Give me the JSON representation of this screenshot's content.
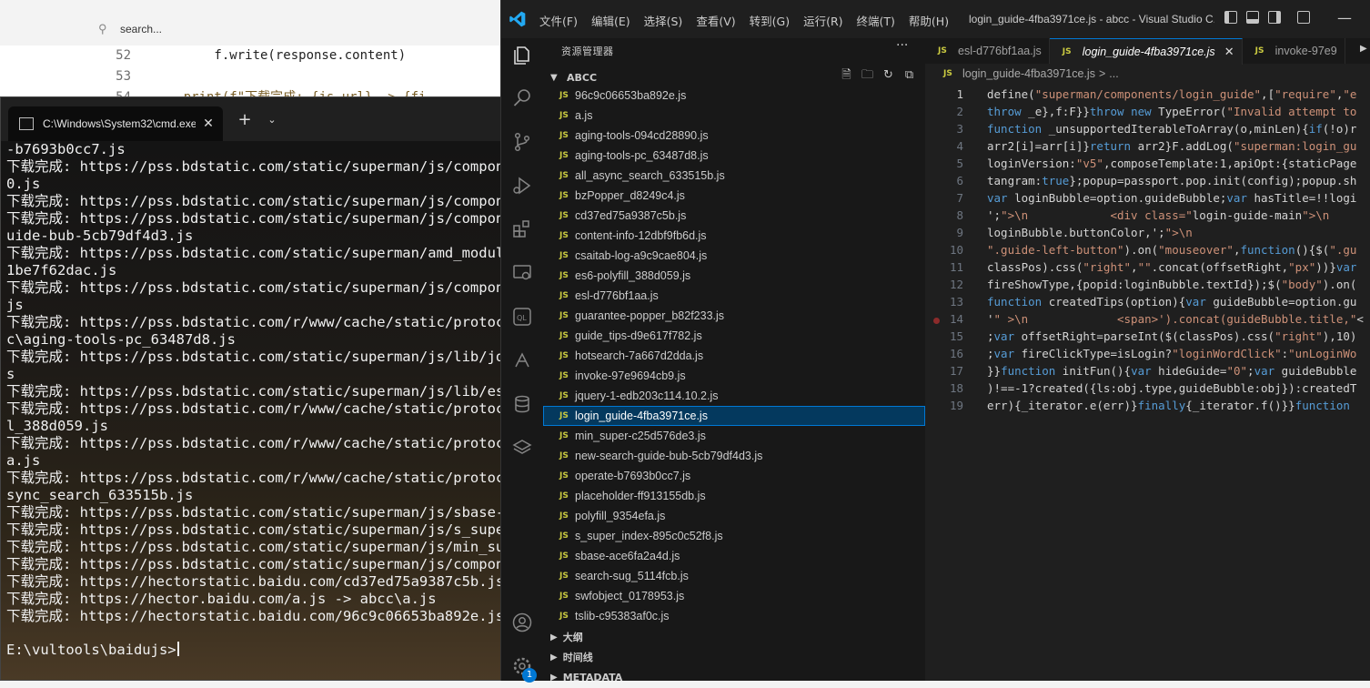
{
  "bg_editor": {
    "search_placeholder": "search...",
    "lines": [
      {
        "num": "52",
        "text": "        f.write(response.content)"
      },
      {
        "num": "53",
        "text": ""
      },
      {
        "num": "54",
        "text": "    print(f\"下载完成: {js_url} -> {fi"
      }
    ]
  },
  "cmd": {
    "tab_title": "C:\\Windows\\System32\\cmd.exe",
    "lines": [
      "-b7693b0cc7.js",
      "下载完成: https://pss.bdstatic.com/static/superman/js/compone",
      "0.js",
      "下载完成: https://pss.bdstatic.com/static/superman/js/compone",
      "下载完成: https://pss.bdstatic.com/static/superman/js/compone",
      "uide-bub-5cb79df4d3.js",
      "下载完成: https://pss.bdstatic.com/static/superman/amd_module",
      "1be7f62dac.js",
      "下载完成: https://pss.bdstatic.com/static/superman/js/compone",
      "js",
      "下载完成: https://pss.bdstatic.com/r/www/cache/static/protoco",
      "c\\aging-tools-pc_63487d8.js",
      "下载完成: https://pss.bdstatic.com/static/superman/js/lib/jqu",
      "s",
      "下载完成: https://pss.bdstatic.com/static/superman/js/lib/esl",
      "下载完成: https://pss.bdstatic.com/r/www/cache/static/protoco",
      "l_388d059.js",
      "下载完成: https://pss.bdstatic.com/r/www/cache/static/protoco",
      "a.js",
      "下载完成: https://pss.bdstatic.com/r/www/cache/static/protoco",
      "sync_search_633515b.js",
      "下载完成: https://pss.bdstatic.com/static/superman/js/sbase-a",
      "下载完成: https://pss.bdstatic.com/static/superman/js/s_super",
      "下载完成: https://pss.bdstatic.com/static/superman/js/min_sup",
      "下载完成: https://pss.bdstatic.com/static/superman/js/compone",
      "下载完成: https://hectorstatic.baidu.com/cd37ed75a9387c5b.js",
      "下载完成: https://hector.baidu.com/a.js -> abcc\\a.js",
      "下载完成: https://hectorstatic.baidu.com/96c9c06653ba892e.js"
    ],
    "prompt": "E:\\vultools\\baidujs>"
  },
  "vscode": {
    "menu": [
      "文件(F)",
      "编辑(E)",
      "选择(S)",
      "查看(V)",
      "转到(G)",
      "运行(R)",
      "终端(T)",
      "帮助(H)"
    ],
    "window_title": "login_guide-4fba3971ce.js - abcc - Visual Studio C...",
    "badge_count": "1",
    "sidebar": {
      "header": "资源管理器",
      "more": "···",
      "folder": "ABCC",
      "files": [
        "96c9c06653ba892e.js",
        "a.js",
        "aging-tools-094cd28890.js",
        "aging-tools-pc_63487d8.js",
        "all_async_search_633515b.js",
        "bzPopper_d8249c4.js",
        "cd37ed75a9387c5b.js",
        "content-info-12dbf9fb6d.js",
        "csaitab-log-a9c9cae804.js",
        "es6-polyfill_388d059.js",
        "esl-d776bf1aa.js",
        "guarantee-popper_b82f233.js",
        "guide_tips-d9e617f782.js",
        "hotsearch-7a667d2dda.js",
        "invoke-97e9694cb9.js",
        "jquery-1-edb203c114.10.2.js",
        "login_guide-4fba3971ce.js",
        "min_super-c25d576de3.js",
        "new-search-guide-bub-5cb79df4d3.js",
        "operate-b7693b0cc7.js",
        "placeholder-ff913155db.js",
        "polyfill_9354efa.js",
        "s_super_index-895c0c52f8.js",
        "sbase-ace6fa2a4d.js",
        "search-sug_5114fcb.js",
        "swfobject_0178953.js",
        "tslib-c95383af0c.js"
      ],
      "active_file": "login_guide-4fba3971ce.js",
      "sections": [
        "大纲",
        "时间线",
        "METADATA"
      ]
    },
    "tabs": [
      {
        "label": "esl-d776bf1aa.js",
        "active": false
      },
      {
        "label": "login_guide-4fba3971ce.js",
        "active": true
      },
      {
        "label": "invoke-97e9",
        "active": false
      }
    ],
    "breadcrumb": [
      "login_guide-4fba3971ce.js",
      ">",
      "..."
    ],
    "code_lines": [
      "define(\"superman/components/login_guide\",[\"require\",\"e",
      "throw _e},f:F}}throw new TypeError(\"Invalid attempt to",
      "function _unsupportedIterableToArray(o,minLen){if(!o)r",
      "arr2[i]=arr[i]}return arr2}F.addLog(\"superman:login_gu",
      "loginVersion:\"v5\",composeTemplate:1,apiOpt:{staticPage",
      "tangram:true};popup=passport.pop.init(config);popup.sh",
      "var loginBubble=option.guideBubble;var hasTitle=!!logi",
      "';\">\\n            <div class=\"login-guide-main\">\\n",
      "loginBubble.buttonColor,';\">\\n",
      "\".guide-left-button\").on(\"mouseover\",function(){$(\".gu",
      "classPos).css(\"right\",\"\".concat(offsetRight,\"px\"))}var",
      "fireShowType,{popid:loginBubble.textId});$(\"body\").on(",
      "function createdTips(option){var guideBubble=option.gu",
      "'\" >\\n             <span>').concat(guideBubble.title,\"<",
      ";var offsetRight=parseInt($(classPos).css(\"right\"),10)",
      ";var fireClickType=isLogin?\"loginWordClick\":\"unLoginWo",
      "}}function initFun(){var hideGuide=\"0\";var guideBubble",
      ")!==-1?created({ls:obj.type,guideBubble:obj}):createdT",
      "err){_iterator.e(err)}finally{_iterator.f()}}function"
    ]
  }
}
